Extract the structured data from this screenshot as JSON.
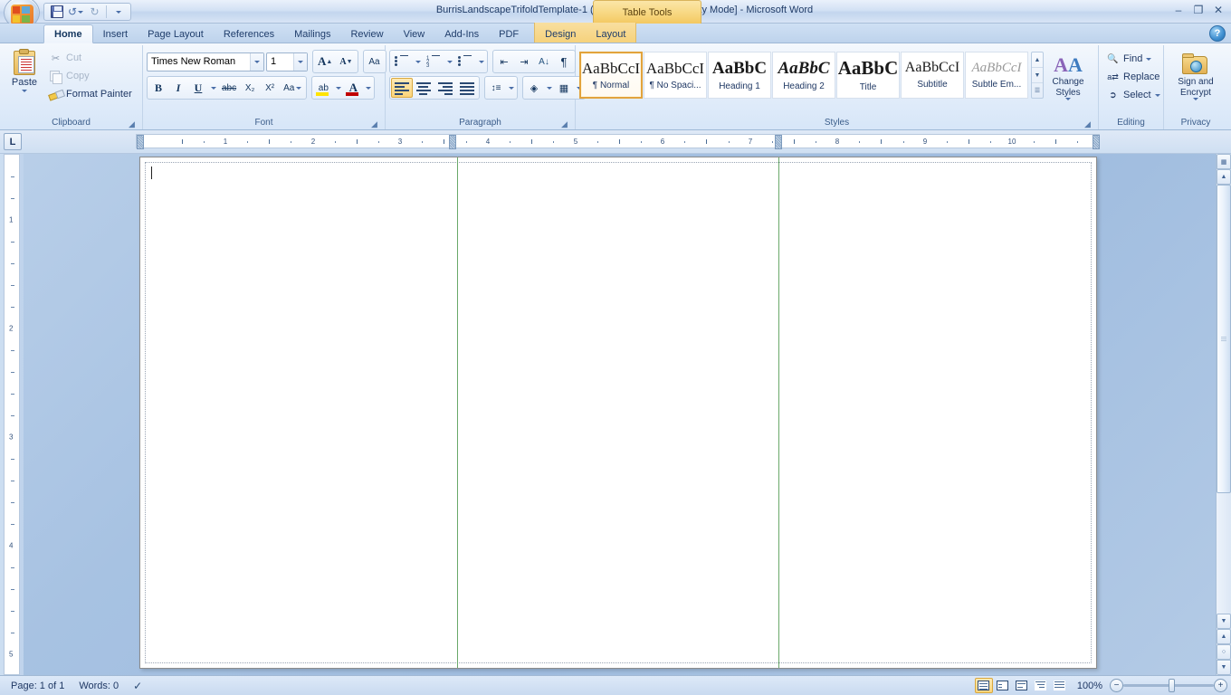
{
  "window": {
    "title": "BurrisLandscapeTrifoldTemplate-1 (Read-Only) [Compatibility Mode] - Microsoft Word",
    "contextual_tab_title": "Table Tools",
    "minimize_label": "–",
    "restore_label": "❐",
    "close_label": "✕",
    "help_label": "?"
  },
  "quick_access": {
    "office_button": "office-button",
    "items": [
      {
        "name": "save",
        "label": "Save"
      },
      {
        "name": "undo",
        "label": "Undo"
      },
      {
        "name": "redo",
        "label": "Redo"
      },
      {
        "name": "customize",
        "label": "Customize Quick Access Toolbar"
      }
    ]
  },
  "tabs": {
    "items": [
      {
        "label": "Home",
        "active": true
      },
      {
        "label": "Insert",
        "active": false
      },
      {
        "label": "Page Layout",
        "active": false
      },
      {
        "label": "References",
        "active": false
      },
      {
        "label": "Mailings",
        "active": false
      },
      {
        "label": "Review",
        "active": false
      },
      {
        "label": "View",
        "active": false
      },
      {
        "label": "Add-Ins",
        "active": false
      },
      {
        "label": "PDF",
        "active": false
      }
    ],
    "contextual": [
      {
        "label": "Design",
        "active": false
      },
      {
        "label": "Layout",
        "active": false
      }
    ]
  },
  "ribbon": {
    "clipboard": {
      "group_label": "Clipboard",
      "paste_label": "Paste",
      "cut_label": "Cut",
      "copy_label": "Copy",
      "format_painter_label": "Format Painter",
      "cut_enabled": false,
      "copy_enabled": false
    },
    "font": {
      "group_label": "Font",
      "font_name": "Times New Roman",
      "font_size": "1",
      "grow_label": "A",
      "shrink_label": "A",
      "clear_formatting_label": "Aa",
      "bold_label": "B",
      "italic_label": "I",
      "underline_label": "U",
      "strikethrough_label": "abc",
      "subscript_label": "X₂",
      "superscript_label": "X²",
      "change_case_label": "Aa",
      "highlight_label": "ab",
      "font_color_label": "A"
    },
    "paragraph": {
      "group_label": "Paragraph",
      "bullets_label": "Bullets",
      "numbering_label": "Numbering",
      "multilevel_label": "Multilevel List",
      "decrease_indent_label": "Decrease Indent",
      "increase_indent_label": "Increase Indent",
      "sort_label": "Sort",
      "show_marks_label": "¶",
      "align_left_label": "Align Left",
      "align_center_label": "Center",
      "align_right_label": "Align Right",
      "justify_label": "Justify",
      "line_spacing_label": "Line Spacing",
      "shading_label": "Shading",
      "borders_label": "Borders",
      "active_alignment": "align-left"
    },
    "styles": {
      "group_label": "Styles",
      "items": [
        {
          "preview": "AaBbCcI",
          "name": "¶ Normal",
          "selected": true,
          "size": 17,
          "weight": "normal",
          "style": "normal"
        },
        {
          "preview": "AaBbCcI",
          "name": "¶ No Spaci...",
          "selected": false,
          "size": 17,
          "weight": "normal",
          "style": "normal"
        },
        {
          "preview": "AaBbC",
          "name": "Heading 1",
          "selected": false,
          "size": 19,
          "weight": "bold",
          "style": "normal"
        },
        {
          "preview": "AaBbC",
          "name": "Heading 2",
          "selected": false,
          "size": 19,
          "weight": "bold",
          "style": "italic"
        },
        {
          "preview": "AaBbC",
          "name": "Title",
          "selected": false,
          "size": 21,
          "weight": "bold",
          "style": "normal"
        },
        {
          "preview": "AaBbCcI",
          "name": "Subtitle",
          "selected": false,
          "size": 16,
          "weight": "normal",
          "style": "normal"
        },
        {
          "preview": "AaBbCcI",
          "name": "Subtle Em...",
          "selected": false,
          "size": 15,
          "weight": "normal",
          "style": "italic"
        }
      ],
      "change_styles_label": "Change Styles"
    },
    "editing": {
      "group_label": "Editing",
      "find_label": "Find",
      "replace_label": "Replace",
      "select_label": "Select"
    },
    "privacy": {
      "group_label": "Privacy",
      "sign_encrypt_label": "Sign and Encrypt"
    }
  },
  "ruler": {
    "tab_selector_label": "L",
    "horizontal_numbers": [
      "1",
      "2",
      "3",
      "4",
      "5",
      "6",
      "7",
      "8",
      "9",
      "10"
    ],
    "vertical_numbers": [
      "1",
      "2",
      "3",
      "4",
      "5"
    ]
  },
  "document": {
    "page_background": "#ffffff",
    "column_divider_color": "#6aa96a",
    "columns": 3
  },
  "status_bar": {
    "page_label": "Page: 1 of 1",
    "words_label": "Words: 0",
    "proofing_label": "Proofing errors",
    "zoom_label": "100%",
    "zoom_out_label": "−",
    "zoom_in_label": "+",
    "views": [
      {
        "name": "print-layout",
        "label": "Print Layout",
        "selected": true
      },
      {
        "name": "full-screen-reading",
        "label": "Full Screen Reading",
        "selected": false
      },
      {
        "name": "web-layout",
        "label": "Web Layout",
        "selected": false
      },
      {
        "name": "outline",
        "label": "Outline",
        "selected": false
      },
      {
        "name": "draft",
        "label": "Draft",
        "selected": false
      }
    ]
  },
  "colors": {
    "accent": "#1f3864",
    "selected_gold": "#fbd47a",
    "contextual_tab": "#f6d27c",
    "table_column_line": "#6aa96a"
  }
}
